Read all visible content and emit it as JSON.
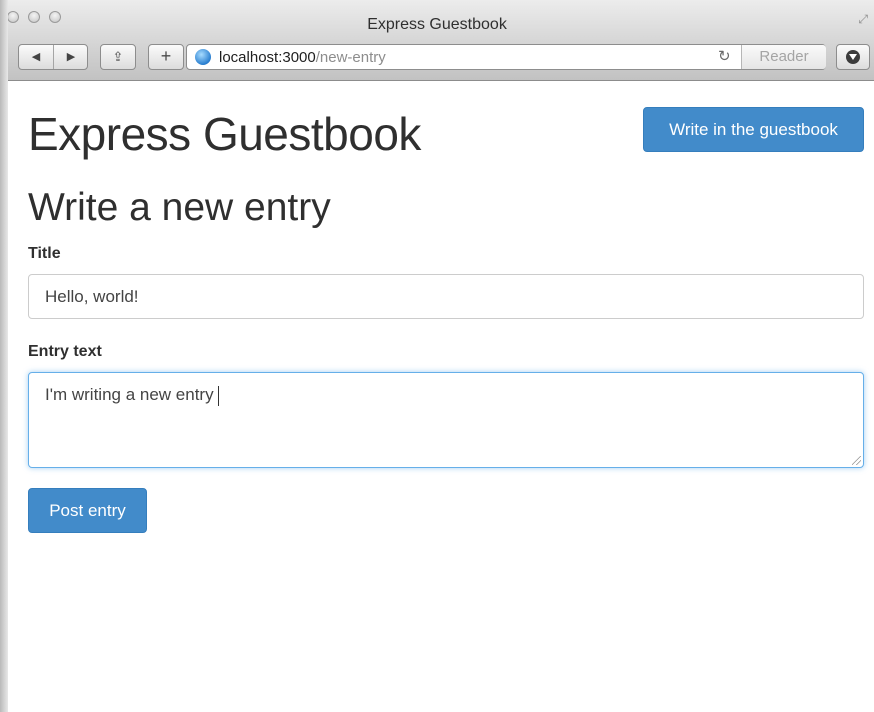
{
  "window": {
    "title": "Express Guestbook"
  },
  "toolbar": {
    "back_glyph": "◀",
    "forward_glyph": "▶",
    "share_glyph": "⇪",
    "newtab_glyph": "+",
    "reload_glyph": "↻",
    "url_host": "localhost:3000",
    "url_path": "/new-entry",
    "reader_label": "Reader",
    "icons": [
      "back-icon",
      "forward-icon",
      "share-icon",
      "plus-icon",
      "globe-icon",
      "reload-icon",
      "downloads-icon",
      "fullscreen-icon"
    ]
  },
  "page": {
    "brand": "Express Guestbook",
    "write_button": "Write in the guestbook",
    "heading": "Write a new entry",
    "form": {
      "title_label": "Title",
      "title_value": "Hello, world!",
      "entry_label": "Entry text",
      "entry_value": "I'm writing a new entry",
      "submit_label": "Post entry"
    }
  },
  "colors": {
    "primary_button": "#428bca",
    "focus_border": "#66afe9",
    "text": "#2f2f2f"
  }
}
